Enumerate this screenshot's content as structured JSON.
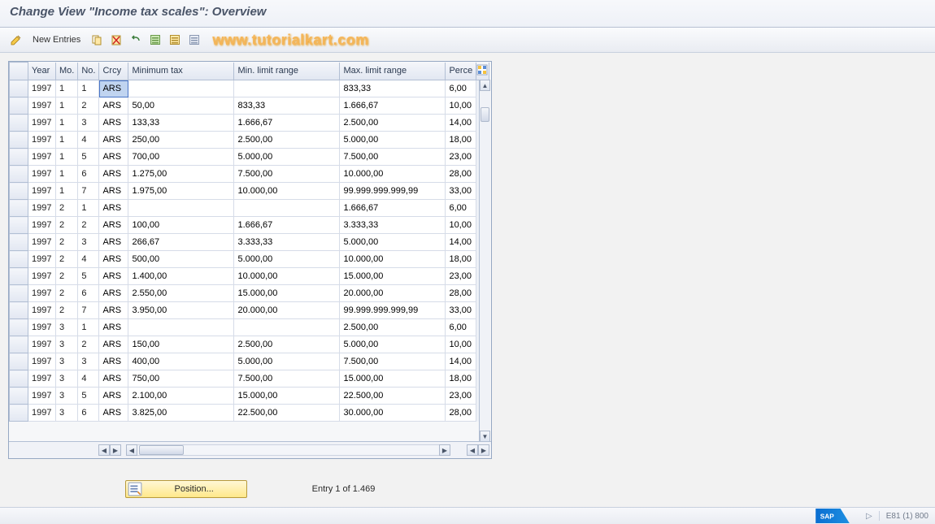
{
  "title": "Change View \"Income tax scales\": Overview",
  "toolbar": {
    "change_icon_tip": "Change",
    "new_entries_label": "New Entries",
    "watermark": "www.tutorialkart.com"
  },
  "columns": {
    "year": "Year",
    "month": "Mo.",
    "no": "No.",
    "crcy": "Crcy",
    "min_tax": "Minimum tax",
    "min_limit": "Min. limit range",
    "max_limit": "Max. limit range",
    "percent": "Perce"
  },
  "rows": [
    {
      "year": "1997",
      "mo": "1",
      "no": "1",
      "crcy": "ARS",
      "min_tax": "",
      "min_limit": "",
      "max_limit": "833,33",
      "pct": "6,00"
    },
    {
      "year": "1997",
      "mo": "1",
      "no": "2",
      "crcy": "ARS",
      "min_tax": "50,00",
      "min_limit": "833,33",
      "max_limit": "1.666,67",
      "pct": "10,00"
    },
    {
      "year": "1997",
      "mo": "1",
      "no": "3",
      "crcy": "ARS",
      "min_tax": "133,33",
      "min_limit": "1.666,67",
      "max_limit": "2.500,00",
      "pct": "14,00"
    },
    {
      "year": "1997",
      "mo": "1",
      "no": "4",
      "crcy": "ARS",
      "min_tax": "250,00",
      "min_limit": "2.500,00",
      "max_limit": "5.000,00",
      "pct": "18,00"
    },
    {
      "year": "1997",
      "mo": "1",
      "no": "5",
      "crcy": "ARS",
      "min_tax": "700,00",
      "min_limit": "5.000,00",
      "max_limit": "7.500,00",
      "pct": "23,00"
    },
    {
      "year": "1997",
      "mo": "1",
      "no": "6",
      "crcy": "ARS",
      "min_tax": "1.275,00",
      "min_limit": "7.500,00",
      "max_limit": "10.000,00",
      "pct": "28,00"
    },
    {
      "year": "1997",
      "mo": "1",
      "no": "7",
      "crcy": "ARS",
      "min_tax": "1.975,00",
      "min_limit": "10.000,00",
      "max_limit": "99.999.999.999,99",
      "pct": "33,00"
    },
    {
      "year": "1997",
      "mo": "2",
      "no": "1",
      "crcy": "ARS",
      "min_tax": "",
      "min_limit": "",
      "max_limit": "1.666,67",
      "pct": "6,00"
    },
    {
      "year": "1997",
      "mo": "2",
      "no": "2",
      "crcy": "ARS",
      "min_tax": "100,00",
      "min_limit": "1.666,67",
      "max_limit": "3.333,33",
      "pct": "10,00"
    },
    {
      "year": "1997",
      "mo": "2",
      "no": "3",
      "crcy": "ARS",
      "min_tax": "266,67",
      "min_limit": "3.333,33",
      "max_limit": "5.000,00",
      "pct": "14,00"
    },
    {
      "year": "1997",
      "mo": "2",
      "no": "4",
      "crcy": "ARS",
      "min_tax": "500,00",
      "min_limit": "5.000,00",
      "max_limit": "10.000,00",
      "pct": "18,00"
    },
    {
      "year": "1997",
      "mo": "2",
      "no": "5",
      "crcy": "ARS",
      "min_tax": "1.400,00",
      "min_limit": "10.000,00",
      "max_limit": "15.000,00",
      "pct": "23,00"
    },
    {
      "year": "1997",
      "mo": "2",
      "no": "6",
      "crcy": "ARS",
      "min_tax": "2.550,00",
      "min_limit": "15.000,00",
      "max_limit": "20.000,00",
      "pct": "28,00"
    },
    {
      "year": "1997",
      "mo": "2",
      "no": "7",
      "crcy": "ARS",
      "min_tax": "3.950,00",
      "min_limit": "20.000,00",
      "max_limit": "99.999.999.999,99",
      "pct": "33,00"
    },
    {
      "year": "1997",
      "mo": "3",
      "no": "1",
      "crcy": "ARS",
      "min_tax": "",
      "min_limit": "",
      "max_limit": "2.500,00",
      "pct": "6,00"
    },
    {
      "year": "1997",
      "mo": "3",
      "no": "2",
      "crcy": "ARS",
      "min_tax": "150,00",
      "min_limit": "2.500,00",
      "max_limit": "5.000,00",
      "pct": "10,00"
    },
    {
      "year": "1997",
      "mo": "3",
      "no": "3",
      "crcy": "ARS",
      "min_tax": "400,00",
      "min_limit": "5.000,00",
      "max_limit": "7.500,00",
      "pct": "14,00"
    },
    {
      "year": "1997",
      "mo": "3",
      "no": "4",
      "crcy": "ARS",
      "min_tax": "750,00",
      "min_limit": "7.500,00",
      "max_limit": "15.000,00",
      "pct": "18,00"
    },
    {
      "year": "1997",
      "mo": "3",
      "no": "5",
      "crcy": "ARS",
      "min_tax": "2.100,00",
      "min_limit": "15.000,00",
      "max_limit": "22.500,00",
      "pct": "23,00"
    },
    {
      "year": "1997",
      "mo": "3",
      "no": "6",
      "crcy": "ARS",
      "min_tax": "3.825,00",
      "min_limit": "22.500,00",
      "max_limit": "30.000,00",
      "pct": "28,00"
    }
  ],
  "footer": {
    "position_label": "Position...",
    "entry_text": "Entry 1 of 1.469"
  },
  "statusbar": {
    "session": "E81 (1) 800"
  }
}
